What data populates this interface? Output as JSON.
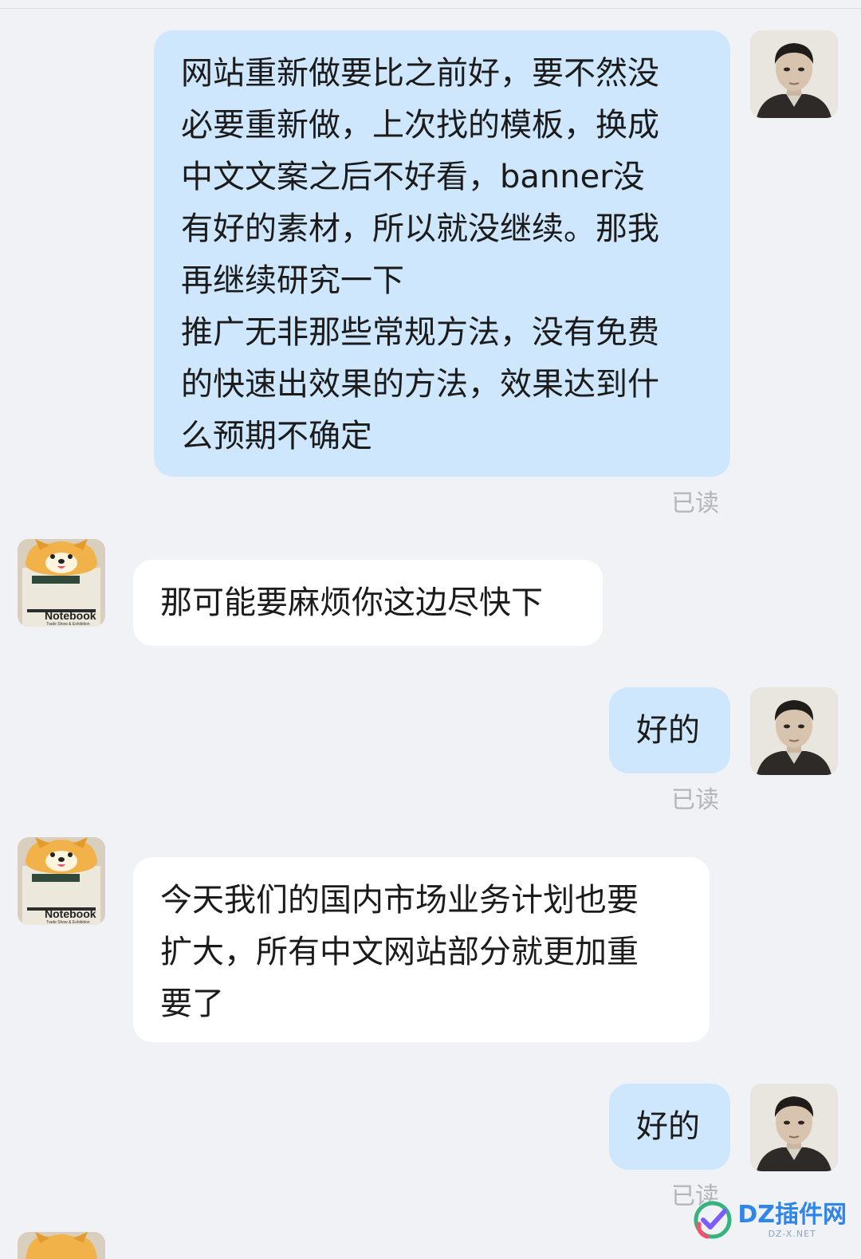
{
  "messages": [
    {
      "side": "me",
      "lines": [
        "网站重新做要比之前好，要不然没",
        "必要重新做，上次找的模板，换成",
        "中文文案之后不好看，banner没",
        "有好的素材，所以就没继续。那我",
        "再继续研究一下",
        "推广无非那些常规方法，没有免费",
        "的快速出效果的方法，效果达到什",
        "么预期不确定"
      ],
      "status": "已读"
    },
    {
      "side": "them",
      "lines": [
        "那可能要麻烦你这边尽快下"
      ]
    },
    {
      "side": "me",
      "lines": [
        "好的"
      ],
      "status": "已读"
    },
    {
      "side": "them",
      "lines": [
        "今天我们的国内市场业务计划也要",
        "扩大，所有中文网站部分就更加重",
        "要了"
      ]
    },
    {
      "side": "me",
      "lines": [
        "好的"
      ],
      "status": "已读"
    }
  ],
  "avatars": {
    "contact_sign_text": "Notebook",
    "contact_sign_subtext": "Trade Show & Exhibition"
  },
  "watermark": {
    "text": "DZ插件网",
    "subtext": "DZ-X.NET"
  },
  "colors": {
    "background": "#f1f2f6",
    "my_bubble": "#cfe7fc",
    "their_bubble": "#ffffff",
    "read_status": "#b3b5ba",
    "watermark": "#2f86e8"
  }
}
